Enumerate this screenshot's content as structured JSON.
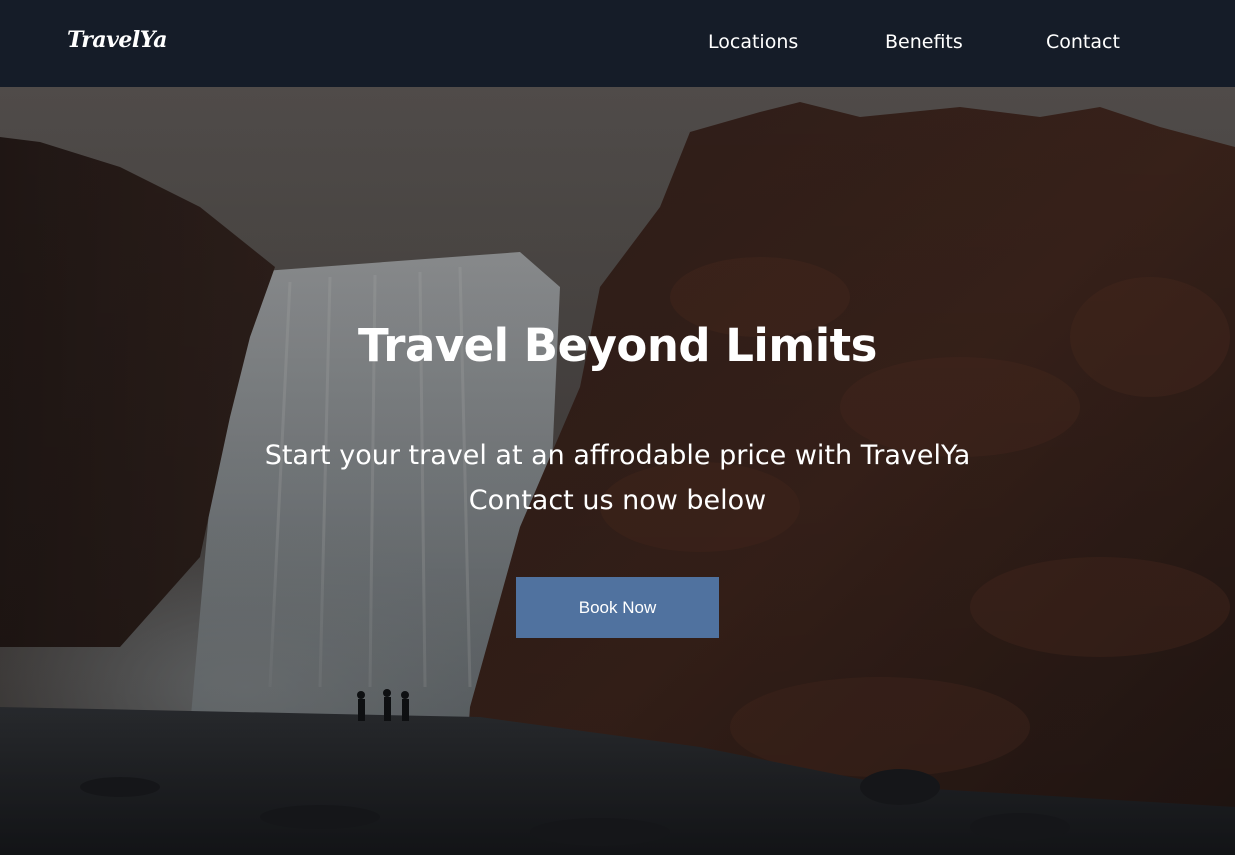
{
  "navbar": {
    "logo": "TravelYa",
    "links": [
      {
        "label": "Locations"
      },
      {
        "label": "Benefits"
      },
      {
        "label": "Contact"
      }
    ]
  },
  "hero": {
    "title": "Travel Beyond Limits",
    "subtitle_line1": "Start your travel at an affrodable price with TravelYa",
    "subtitle_line2": "Contact us now below",
    "cta_label": "Book Now"
  },
  "colors": {
    "navbar_bg": "#151c28",
    "button_bg": "#50729f",
    "text": "#ffffff"
  }
}
